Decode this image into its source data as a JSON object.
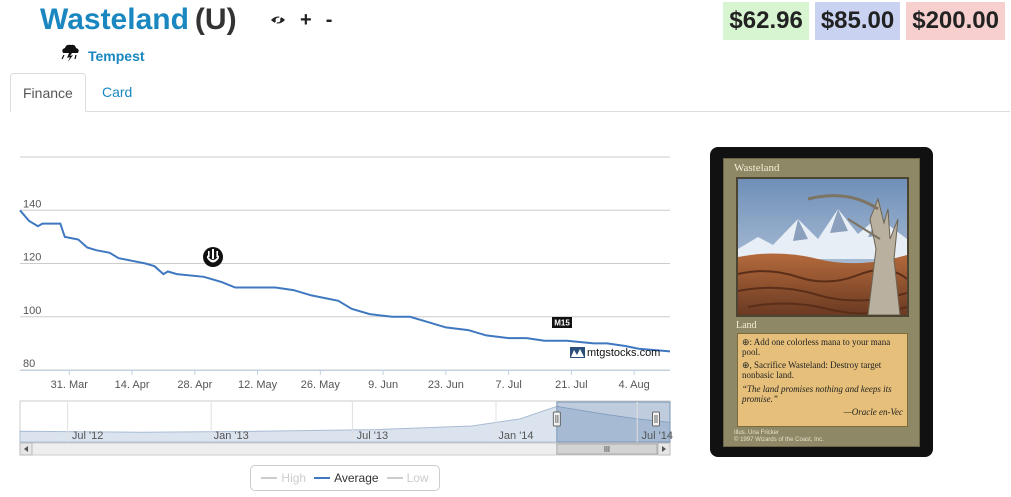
{
  "header": {
    "card_name": "Wasteland",
    "rarity": "(U)",
    "plus_label": "+",
    "minus_label": "-",
    "set_name": "Tempest"
  },
  "prices": {
    "low": "$62.96",
    "average": "$85.00",
    "high": "$200.00",
    "colors": {
      "low": "#d6f5d0",
      "average": "#c9d3f1",
      "high": "#f7cfcf"
    }
  },
  "tabs": [
    {
      "label": "Finance",
      "active": true
    },
    {
      "label": "Card",
      "active": false
    }
  ],
  "chart_data": {
    "type": "line",
    "series": [
      {
        "name": "Average",
        "color": "#3f78c0",
        "points": [
          [
            "2014-03-20",
            140
          ],
          [
            "2014-03-22",
            136
          ],
          [
            "2014-03-24",
            134
          ],
          [
            "2014-03-25",
            135
          ],
          [
            "2014-03-29",
            135
          ],
          [
            "2014-03-30",
            130
          ],
          [
            "2014-04-02",
            129
          ],
          [
            "2014-04-04",
            126
          ],
          [
            "2014-04-06",
            125
          ],
          [
            "2014-04-09",
            124
          ],
          [
            "2014-04-11",
            122
          ],
          [
            "2014-04-14",
            121
          ],
          [
            "2014-04-17",
            120
          ],
          [
            "2014-04-19",
            119
          ],
          [
            "2014-04-21",
            116
          ],
          [
            "2014-04-22",
            117
          ],
          [
            "2014-04-24",
            116
          ],
          [
            "2014-04-30",
            115
          ],
          [
            "2014-05-04",
            113
          ],
          [
            "2014-05-07",
            111
          ],
          [
            "2014-05-16",
            111
          ],
          [
            "2014-05-20",
            110
          ],
          [
            "2014-05-24",
            108
          ],
          [
            "2014-05-30",
            106
          ],
          [
            "2014-06-02",
            103
          ],
          [
            "2014-06-06",
            101
          ],
          [
            "2014-06-11",
            100
          ],
          [
            "2014-06-15",
            100
          ],
          [
            "2014-06-19",
            98
          ],
          [
            "2014-06-23",
            96
          ],
          [
            "2014-06-28",
            95
          ],
          [
            "2014-07-02",
            93
          ],
          [
            "2014-07-07",
            92
          ],
          [
            "2014-07-11",
            92
          ],
          [
            "2014-07-15",
            91
          ],
          [
            "2014-07-20",
            91
          ],
          [
            "2014-07-26",
            90
          ],
          [
            "2014-07-29",
            90
          ],
          [
            "2014-08-02",
            89
          ],
          [
            "2014-08-05",
            88
          ],
          [
            "2014-08-12",
            87
          ]
        ]
      }
    ],
    "y_ticks": [
      "80",
      "100",
      "120",
      "140"
    ],
    "ylim": [
      80,
      160
    ],
    "x_ticks": [
      "31. Mar",
      "14. Apr",
      "28. Apr",
      "12. May",
      "26. May",
      "9. Jun",
      "23. Jun",
      "7. Jul",
      "21. Jul",
      "4. Aug"
    ],
    "x_range": [
      "2014-03-20",
      "2014-08-12"
    ],
    "navigator_ticks": [
      "Jul '12",
      "Jan '13",
      "Jul '13",
      "Jan '14",
      "Jul '14"
    ],
    "navigator_range": [
      "2012-05-01",
      "2014-08-12"
    ],
    "navigator_selection": [
      "2014-03-20",
      "2014-08-12"
    ],
    "annotations": [
      {
        "date": "2014-04-30",
        "label": "set-symbol-icon"
      },
      {
        "date": "2014-07-18",
        "label": "M15"
      }
    ],
    "credit": "mtgstocks.com",
    "legend": [
      "High",
      "Average",
      "Low"
    ],
    "grid": true
  },
  "card_image": {
    "name": "Wasteland",
    "type_line": "Land",
    "ability_1": ": Add one colorless mana to your mana pool.",
    "ability_2": ", Sacrifice Wasteland: Destroy target nonbasic land.",
    "flavor": "“The land promises nothing and keeps its promise.”",
    "flavor_attr": "—Oracle en-Vec",
    "illustrator": "Illus. Una Fricker",
    "copyright": "© 1997 Wizards of the Coast, Inc."
  }
}
